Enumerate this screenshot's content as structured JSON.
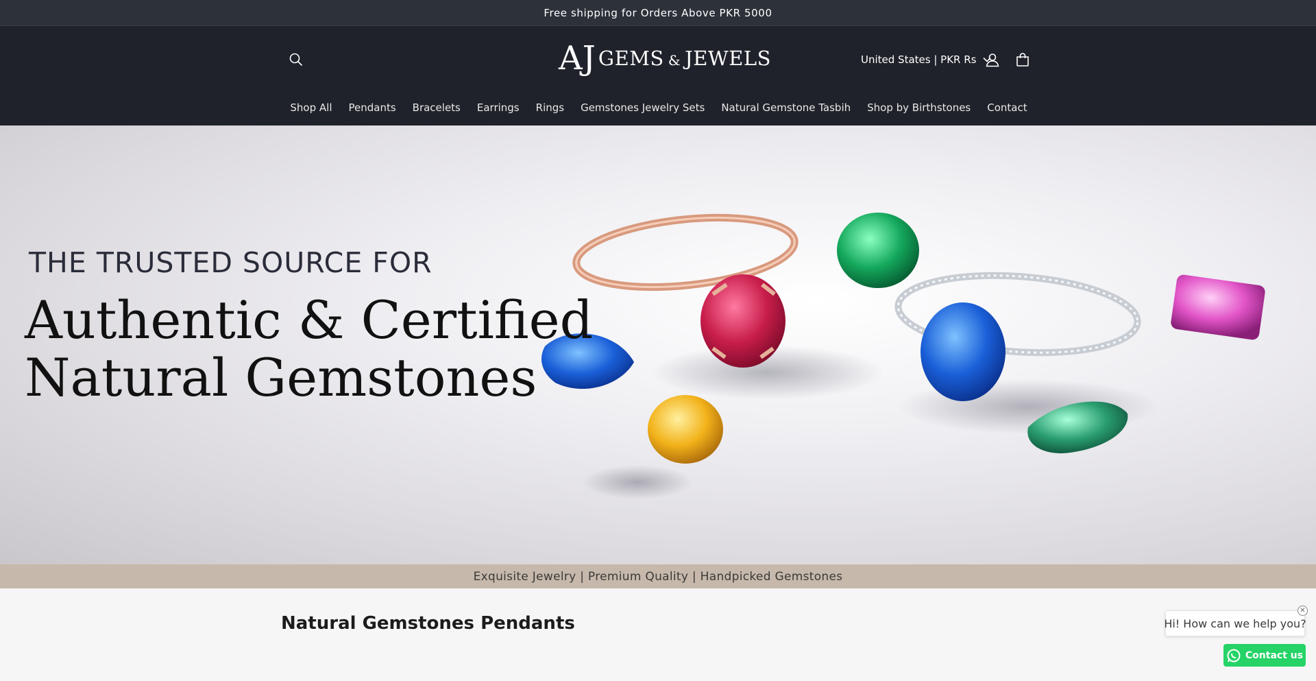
{
  "announcement": {
    "text": "Free shipping for Orders Above PKR 5000"
  },
  "header": {
    "logo": {
      "monogram": "AJ",
      "word1": "GEMS",
      "amp": "&",
      "word2": "JEWELS"
    },
    "country_selector": "United States | PKR Rs",
    "icons": {
      "search": "search-icon",
      "account": "account-icon",
      "cart": "cart-icon",
      "dropdown": "chevron-down-icon"
    }
  },
  "nav": {
    "items": [
      {
        "label": "Shop All"
      },
      {
        "label": "Pendants"
      },
      {
        "label": "Bracelets"
      },
      {
        "label": "Earrings"
      },
      {
        "label": "Rings"
      },
      {
        "label": "Gemstones Jewelry Sets"
      },
      {
        "label": "Natural Gemstone Tasbih"
      },
      {
        "label": "Shop by Birthstones"
      },
      {
        "label": "Contact"
      }
    ]
  },
  "hero": {
    "kicker": "THE TRUSTED SOURCE FOR",
    "title_line1": "Authentic & Certified",
    "title_line2": "Natural Gemstones"
  },
  "tagline": {
    "text": "Exquisite Jewelry | Premium Quality | Handpicked Gemstones"
  },
  "section": {
    "title": "Natural Gemstones Pendants"
  },
  "chat": {
    "bubble_text": "Hi! How can we help you?",
    "button_label": "Contact us",
    "close_symbol": "✕"
  },
  "colors": {
    "announcement_bg": "#2d313a",
    "header_bg": "#1f222a",
    "tagline_bg": "#c6b8ab",
    "whatsapp": "#25d366"
  }
}
